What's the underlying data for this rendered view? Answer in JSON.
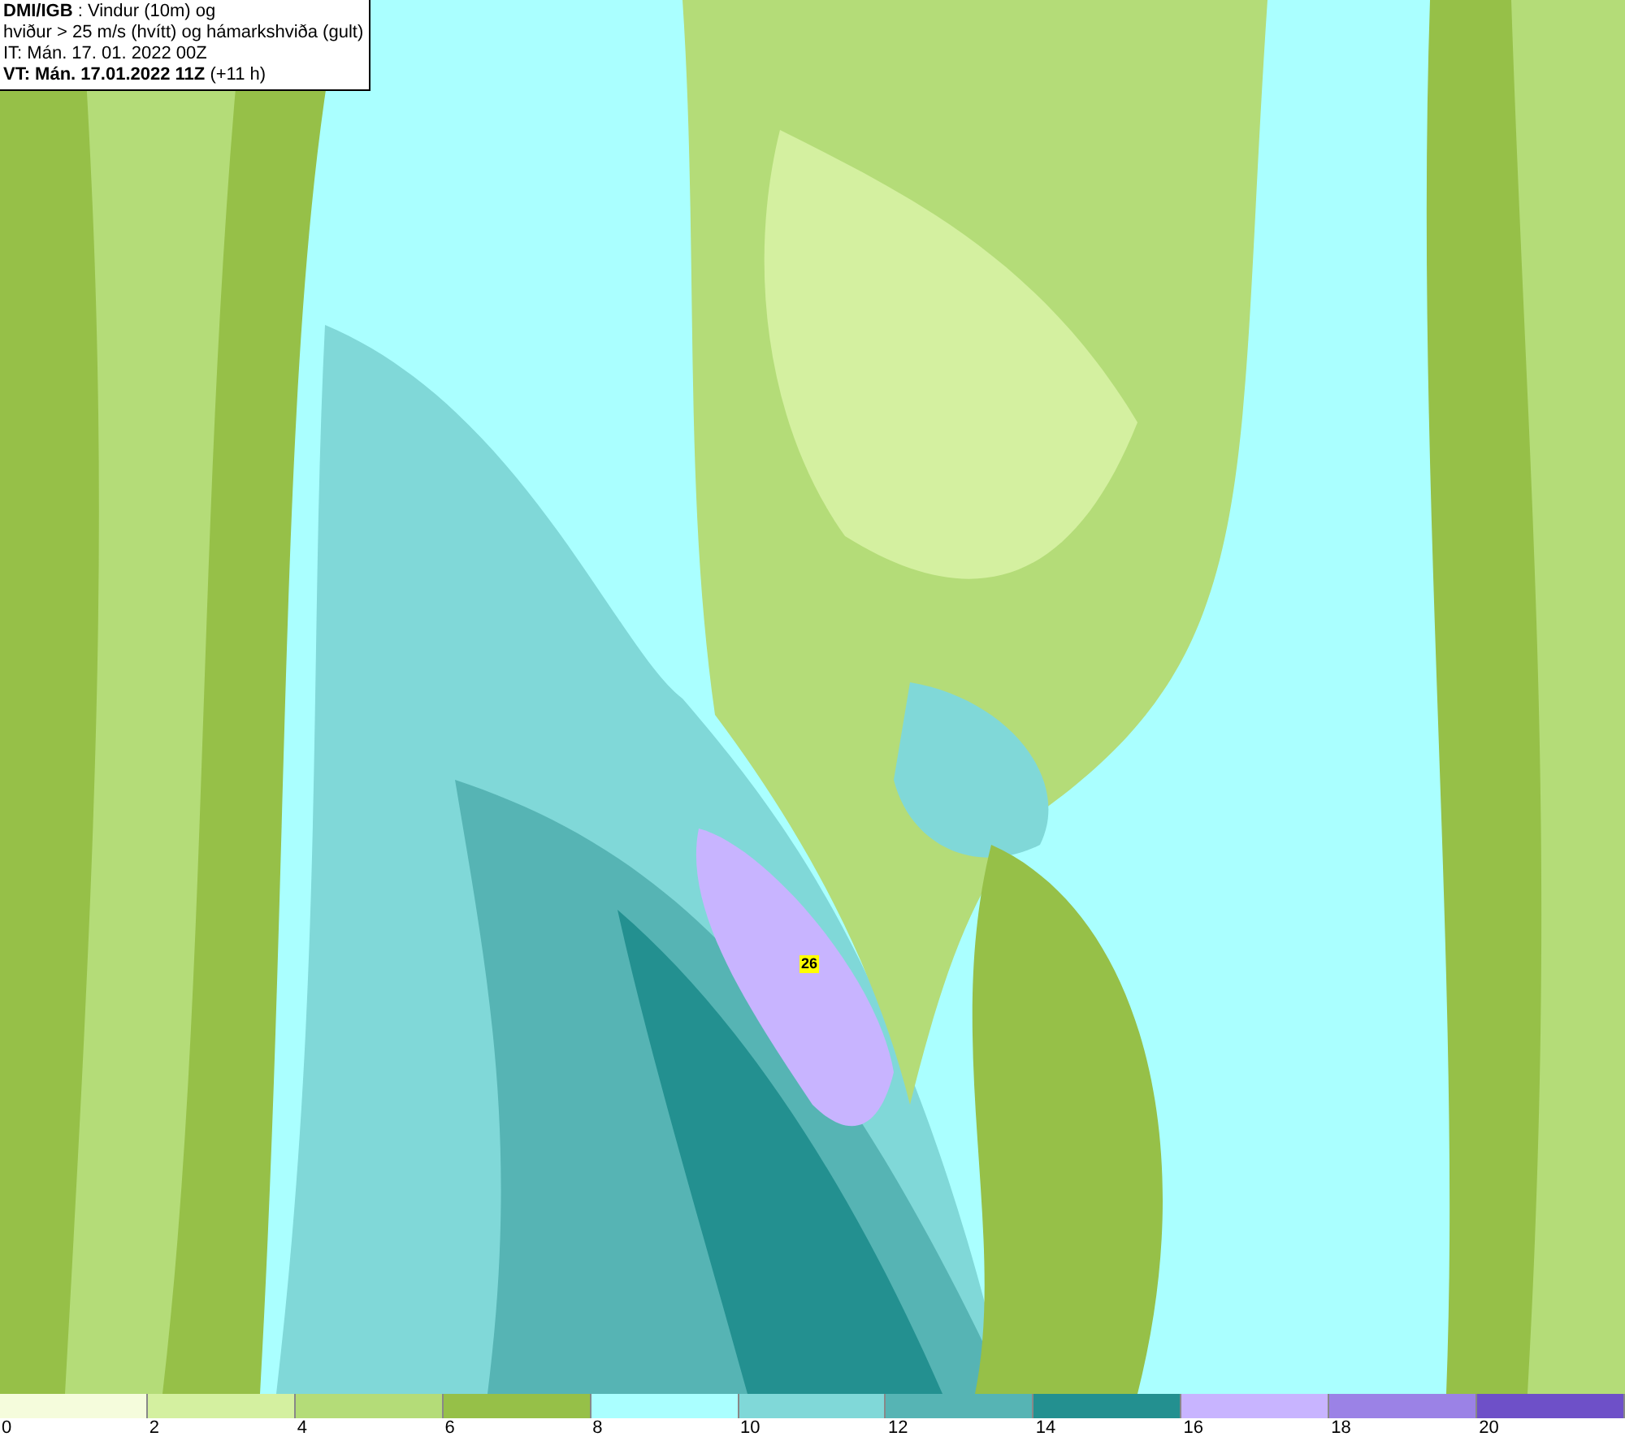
{
  "header": {
    "source": "DMI/IGB",
    "title_rest": " : Vindur (10m) og",
    "line_2": "hviður > 25 m/s (hvítt) og hámarkshviða (gult)",
    "line_3": "IT: Mán. 17. 01. 2022 00Z",
    "valid_time": "VT: Mán. 17.01.2022 11Z",
    "offset": " (+11 h)"
  },
  "map": {
    "max_gust_label": "26"
  },
  "legend": [
    {
      "color": "#f5fcdc",
      "label": "0"
    },
    {
      "color": "#d4f0a0",
      "label": "2"
    },
    {
      "color": "#b4dc78",
      "label": "4"
    },
    {
      "color": "#96c048",
      "label": "6"
    },
    {
      "color": "#aaffff",
      "label": "8"
    },
    {
      "color": "#80d8d8",
      "label": "10"
    },
    {
      "color": "#56b4b4",
      "label": "12"
    },
    {
      "color": "#239090",
      "label": "14"
    },
    {
      "color": "#c8b4ff",
      "label": "16"
    },
    {
      "color": "#9b82e6",
      "label": "18"
    },
    {
      "color": "#6e50c8",
      "label": "20"
    }
  ]
}
